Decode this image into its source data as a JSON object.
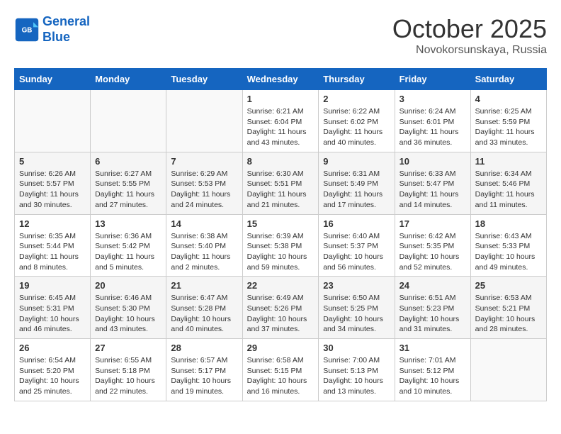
{
  "header": {
    "logo_line1": "General",
    "logo_line2": "Blue",
    "month": "October 2025",
    "location": "Novokorsunskaya, Russia"
  },
  "weekdays": [
    "Sunday",
    "Monday",
    "Tuesday",
    "Wednesday",
    "Thursday",
    "Friday",
    "Saturday"
  ],
  "weeks": [
    [
      {
        "day": "",
        "sunrise": "",
        "sunset": "",
        "daylight": ""
      },
      {
        "day": "",
        "sunrise": "",
        "sunset": "",
        "daylight": ""
      },
      {
        "day": "",
        "sunrise": "",
        "sunset": "",
        "daylight": ""
      },
      {
        "day": "1",
        "sunrise": "Sunrise: 6:21 AM",
        "sunset": "Sunset: 6:04 PM",
        "daylight": "Daylight: 11 hours and 43 minutes."
      },
      {
        "day": "2",
        "sunrise": "Sunrise: 6:22 AM",
        "sunset": "Sunset: 6:02 PM",
        "daylight": "Daylight: 11 hours and 40 minutes."
      },
      {
        "day": "3",
        "sunrise": "Sunrise: 6:24 AM",
        "sunset": "Sunset: 6:01 PM",
        "daylight": "Daylight: 11 hours and 36 minutes."
      },
      {
        "day": "4",
        "sunrise": "Sunrise: 6:25 AM",
        "sunset": "Sunset: 5:59 PM",
        "daylight": "Daylight: 11 hours and 33 minutes."
      }
    ],
    [
      {
        "day": "5",
        "sunrise": "Sunrise: 6:26 AM",
        "sunset": "Sunset: 5:57 PM",
        "daylight": "Daylight: 11 hours and 30 minutes."
      },
      {
        "day": "6",
        "sunrise": "Sunrise: 6:27 AM",
        "sunset": "Sunset: 5:55 PM",
        "daylight": "Daylight: 11 hours and 27 minutes."
      },
      {
        "day": "7",
        "sunrise": "Sunrise: 6:29 AM",
        "sunset": "Sunset: 5:53 PM",
        "daylight": "Daylight: 11 hours and 24 minutes."
      },
      {
        "day": "8",
        "sunrise": "Sunrise: 6:30 AM",
        "sunset": "Sunset: 5:51 PM",
        "daylight": "Daylight: 11 hours and 21 minutes."
      },
      {
        "day": "9",
        "sunrise": "Sunrise: 6:31 AM",
        "sunset": "Sunset: 5:49 PM",
        "daylight": "Daylight: 11 hours and 17 minutes."
      },
      {
        "day": "10",
        "sunrise": "Sunrise: 6:33 AM",
        "sunset": "Sunset: 5:47 PM",
        "daylight": "Daylight: 11 hours and 14 minutes."
      },
      {
        "day": "11",
        "sunrise": "Sunrise: 6:34 AM",
        "sunset": "Sunset: 5:46 PM",
        "daylight": "Daylight: 11 hours and 11 minutes."
      }
    ],
    [
      {
        "day": "12",
        "sunrise": "Sunrise: 6:35 AM",
        "sunset": "Sunset: 5:44 PM",
        "daylight": "Daylight: 11 hours and 8 minutes."
      },
      {
        "day": "13",
        "sunrise": "Sunrise: 6:36 AM",
        "sunset": "Sunset: 5:42 PM",
        "daylight": "Daylight: 11 hours and 5 minutes."
      },
      {
        "day": "14",
        "sunrise": "Sunrise: 6:38 AM",
        "sunset": "Sunset: 5:40 PM",
        "daylight": "Daylight: 11 hours and 2 minutes."
      },
      {
        "day": "15",
        "sunrise": "Sunrise: 6:39 AM",
        "sunset": "Sunset: 5:38 PM",
        "daylight": "Daylight: 10 hours and 59 minutes."
      },
      {
        "day": "16",
        "sunrise": "Sunrise: 6:40 AM",
        "sunset": "Sunset: 5:37 PM",
        "daylight": "Daylight: 10 hours and 56 minutes."
      },
      {
        "day": "17",
        "sunrise": "Sunrise: 6:42 AM",
        "sunset": "Sunset: 5:35 PM",
        "daylight": "Daylight: 10 hours and 52 minutes."
      },
      {
        "day": "18",
        "sunrise": "Sunrise: 6:43 AM",
        "sunset": "Sunset: 5:33 PM",
        "daylight": "Daylight: 10 hours and 49 minutes."
      }
    ],
    [
      {
        "day": "19",
        "sunrise": "Sunrise: 6:45 AM",
        "sunset": "Sunset: 5:31 PM",
        "daylight": "Daylight: 10 hours and 46 minutes."
      },
      {
        "day": "20",
        "sunrise": "Sunrise: 6:46 AM",
        "sunset": "Sunset: 5:30 PM",
        "daylight": "Daylight: 10 hours and 43 minutes."
      },
      {
        "day": "21",
        "sunrise": "Sunrise: 6:47 AM",
        "sunset": "Sunset: 5:28 PM",
        "daylight": "Daylight: 10 hours and 40 minutes."
      },
      {
        "day": "22",
        "sunrise": "Sunrise: 6:49 AM",
        "sunset": "Sunset: 5:26 PM",
        "daylight": "Daylight: 10 hours and 37 minutes."
      },
      {
        "day": "23",
        "sunrise": "Sunrise: 6:50 AM",
        "sunset": "Sunset: 5:25 PM",
        "daylight": "Daylight: 10 hours and 34 minutes."
      },
      {
        "day": "24",
        "sunrise": "Sunrise: 6:51 AM",
        "sunset": "Sunset: 5:23 PM",
        "daylight": "Daylight: 10 hours and 31 minutes."
      },
      {
        "day": "25",
        "sunrise": "Sunrise: 6:53 AM",
        "sunset": "Sunset: 5:21 PM",
        "daylight": "Daylight: 10 hours and 28 minutes."
      }
    ],
    [
      {
        "day": "26",
        "sunrise": "Sunrise: 6:54 AM",
        "sunset": "Sunset: 5:20 PM",
        "daylight": "Daylight: 10 hours and 25 minutes."
      },
      {
        "day": "27",
        "sunrise": "Sunrise: 6:55 AM",
        "sunset": "Sunset: 5:18 PM",
        "daylight": "Daylight: 10 hours and 22 minutes."
      },
      {
        "day": "28",
        "sunrise": "Sunrise: 6:57 AM",
        "sunset": "Sunset: 5:17 PM",
        "daylight": "Daylight: 10 hours and 19 minutes."
      },
      {
        "day": "29",
        "sunrise": "Sunrise: 6:58 AM",
        "sunset": "Sunset: 5:15 PM",
        "daylight": "Daylight: 10 hours and 16 minutes."
      },
      {
        "day": "30",
        "sunrise": "Sunrise: 7:00 AM",
        "sunset": "Sunset: 5:13 PM",
        "daylight": "Daylight: 10 hours and 13 minutes."
      },
      {
        "day": "31",
        "sunrise": "Sunrise: 7:01 AM",
        "sunset": "Sunset: 5:12 PM",
        "daylight": "Daylight: 10 hours and 10 minutes."
      },
      {
        "day": "",
        "sunrise": "",
        "sunset": "",
        "daylight": ""
      }
    ]
  ]
}
